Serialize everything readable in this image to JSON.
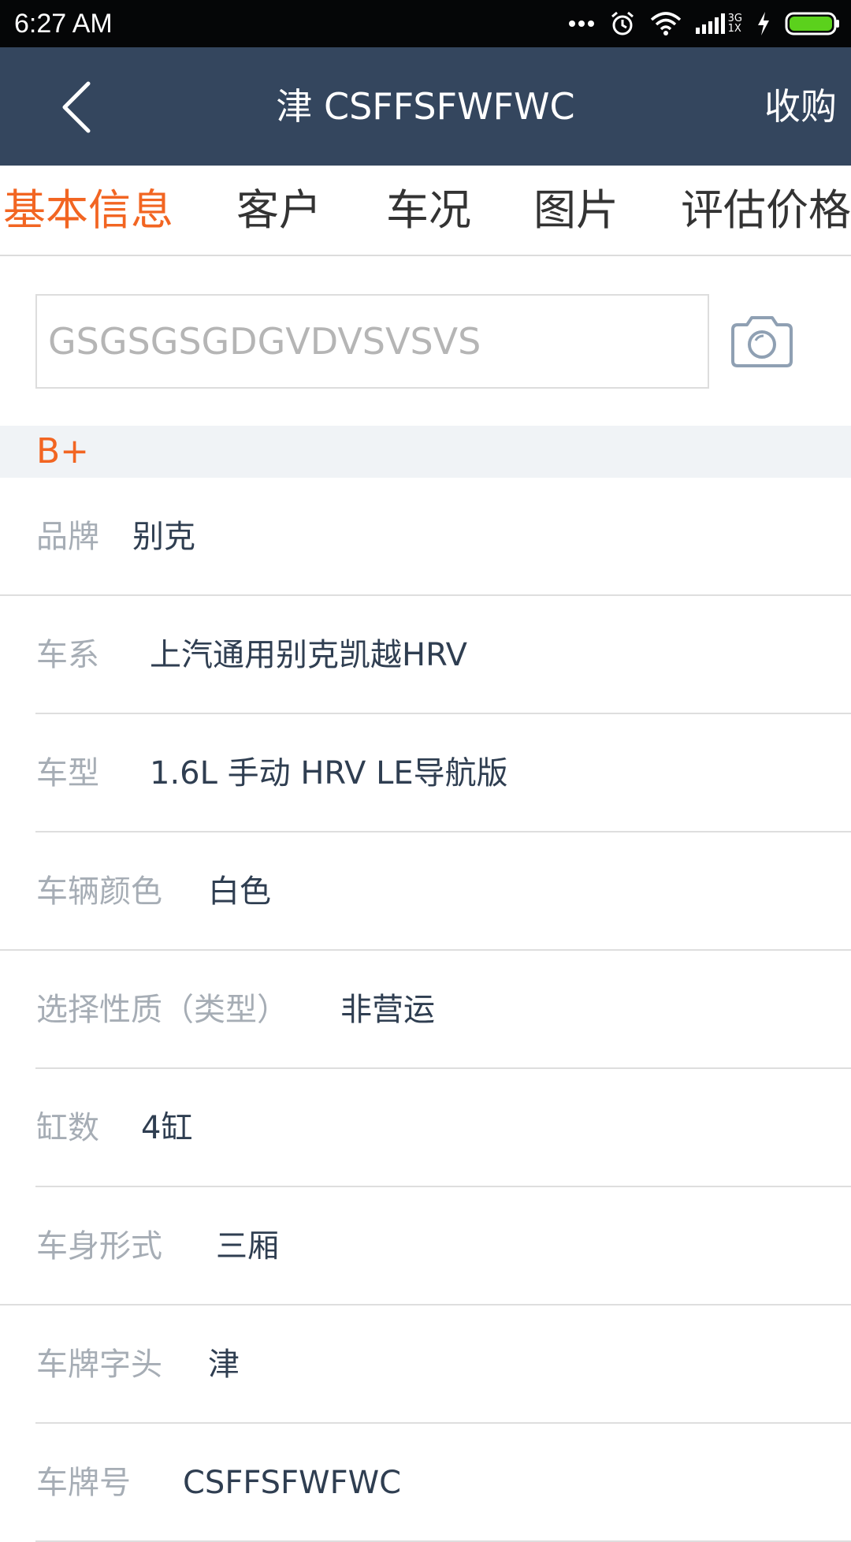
{
  "status_bar": {
    "time": "6:27 AM",
    "icons": [
      "more-dots-icon",
      "alarm-icon",
      "wifi-icon",
      "signal-icon",
      "charging-icon",
      "battery-icon"
    ],
    "network_top": "3G",
    "network_bottom": "1X"
  },
  "header": {
    "title": "津 CSFFSFWFWC",
    "action_label": "收购",
    "background": "#34465e"
  },
  "tabs": [
    {
      "label": "基本信息",
      "active": true
    },
    {
      "label": "客户",
      "active": false
    },
    {
      "label": "车况",
      "active": false
    },
    {
      "label": "图片",
      "active": false
    },
    {
      "label": "评估价格",
      "active": false
    }
  ],
  "vin": {
    "placeholder": "GSGSGSGDGVDVSVSVS"
  },
  "grade": "B+",
  "fields": [
    {
      "label": "品牌",
      "value": "别克"
    },
    {
      "label": "车系",
      "value": "上汽通用别克凯越HRV"
    },
    {
      "label": "车型",
      "value": "1.6L 手动 HRV LE导航版"
    },
    {
      "label": "车辆颜色",
      "value": "白色"
    },
    {
      "label": "选择性质（类型）",
      "value": "非营运"
    },
    {
      "label": "缸数",
      "value": "4缸"
    },
    {
      "label": "车身形式",
      "value": "三厢"
    },
    {
      "label": "车牌字头",
      "value": "津"
    },
    {
      "label": "车牌号",
      "value": "CSFFSFWFWC"
    }
  ],
  "colors": {
    "accent": "#f26522",
    "label": "#a6adb5",
    "value": "#2f3e51"
  }
}
